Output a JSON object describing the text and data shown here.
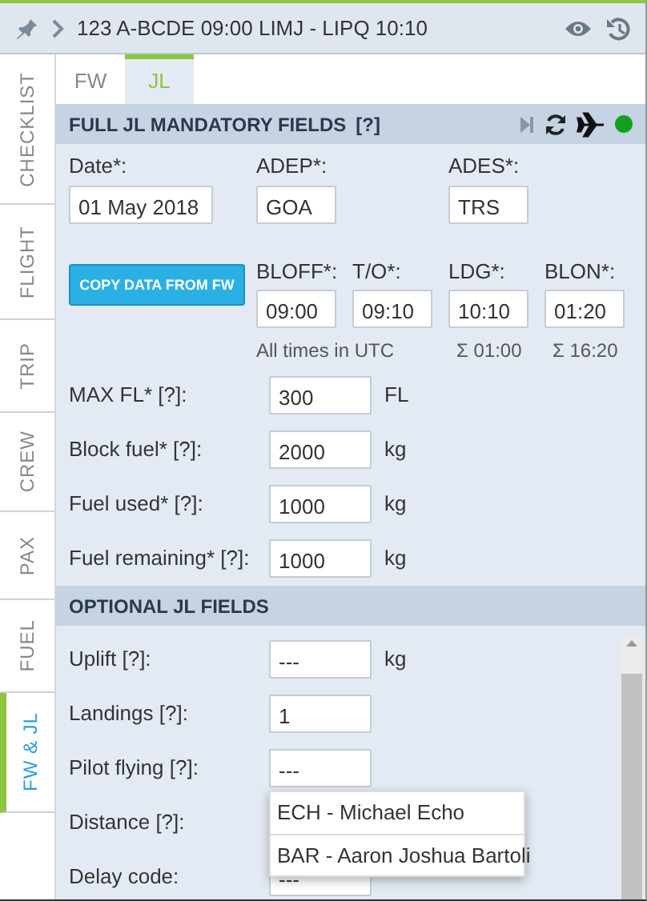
{
  "header": {
    "title": "123 A-BCDE 09:00 LIMJ - LIPQ 10:10"
  },
  "side_tabs": [
    {
      "label": "CHECKLIST",
      "selected": false
    },
    {
      "label": "FLIGHT",
      "selected": false
    },
    {
      "label": "TRIP",
      "selected": false
    },
    {
      "label": "CREW",
      "selected": false
    },
    {
      "label": "PAX",
      "selected": false
    },
    {
      "label": "FUEL",
      "selected": false
    },
    {
      "label": "FW & JL",
      "selected": true
    }
  ],
  "tabs": [
    {
      "label": "FW",
      "selected": false
    },
    {
      "label": "JL",
      "selected": true
    }
  ],
  "mandatory": {
    "title": "FULL JL MANDATORY FIELDS",
    "help": "[?]",
    "route_fields": [
      {
        "label": "Date*:",
        "value": "01 May 2018"
      },
      {
        "label": "ADEP*:",
        "value": "GOA"
      },
      {
        "label": "ADES*:",
        "value": "TRS"
      }
    ],
    "copy_button": "COPY DATA FROM FW",
    "time_fields": [
      {
        "label": "BLOFF*:",
        "value": "09:00"
      },
      {
        "label": "T/O*:",
        "value": "09:10"
      },
      {
        "label": "LDG*:",
        "value": "10:10"
      },
      {
        "label": "BLON*:",
        "value": "01:20"
      }
    ],
    "notes": [
      "All times in UTC",
      "Σ 01:00",
      "Σ 16:20"
    ],
    "rows": [
      {
        "label": "MAX FL*  [?]:",
        "value": "300",
        "unit": "FL"
      },
      {
        "label": "Block fuel*  [?]:",
        "value": "2000",
        "unit": "kg"
      },
      {
        "label": "Fuel used*  [?]:",
        "value": "1000",
        "unit": "kg"
      },
      {
        "label": "Fuel remaining*  [?]:",
        "value": "1000",
        "unit": "kg"
      }
    ]
  },
  "optional": {
    "title": "OPTIONAL JL FIELDS",
    "rows": [
      {
        "label": "Uplift  [?]:",
        "value": "---",
        "unit": "kg"
      },
      {
        "label": "Landings  [?]:",
        "value": "1"
      },
      {
        "label": "Pilot flying  [?]:",
        "value": "---",
        "dropdown": [
          "ECH - Michael Echo",
          "BAR - Aaron Joshua Bartoli"
        ]
      },
      {
        "label": "Distance  [?]:"
      },
      {
        "label": "Delay code:",
        "value": "---"
      }
    ]
  }
}
